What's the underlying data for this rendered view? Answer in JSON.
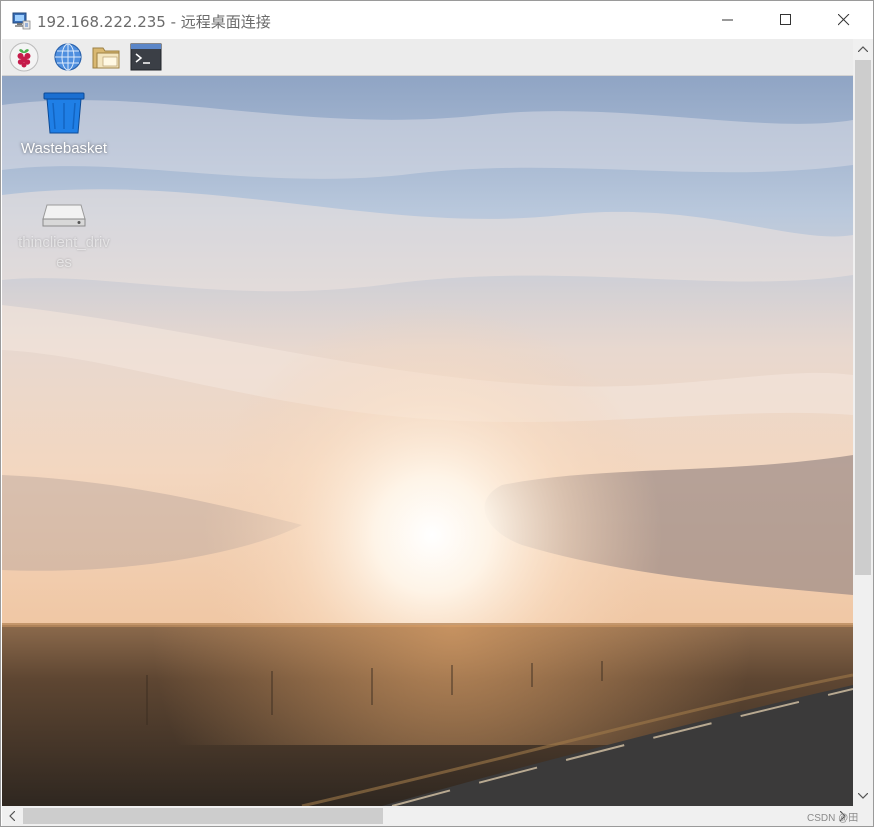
{
  "window": {
    "title": "192.168.222.235 - 远程桌面连接",
    "icon": "remote-desktop-icon"
  },
  "panel": {
    "items": [
      {
        "name": "menu",
        "icon": "raspberry-pi-icon"
      },
      {
        "name": "web-browser",
        "icon": "globe-icon"
      },
      {
        "name": "file-manager",
        "icon": "folder-icon"
      },
      {
        "name": "terminal",
        "icon": "terminal-icon"
      }
    ]
  },
  "desktop": {
    "icons": [
      {
        "label": "Wastebasket",
        "icon": "trash-icon"
      },
      {
        "label": "thinclient_drives",
        "icon": "drive-icon"
      }
    ]
  },
  "watermark": "CSDN @田"
}
